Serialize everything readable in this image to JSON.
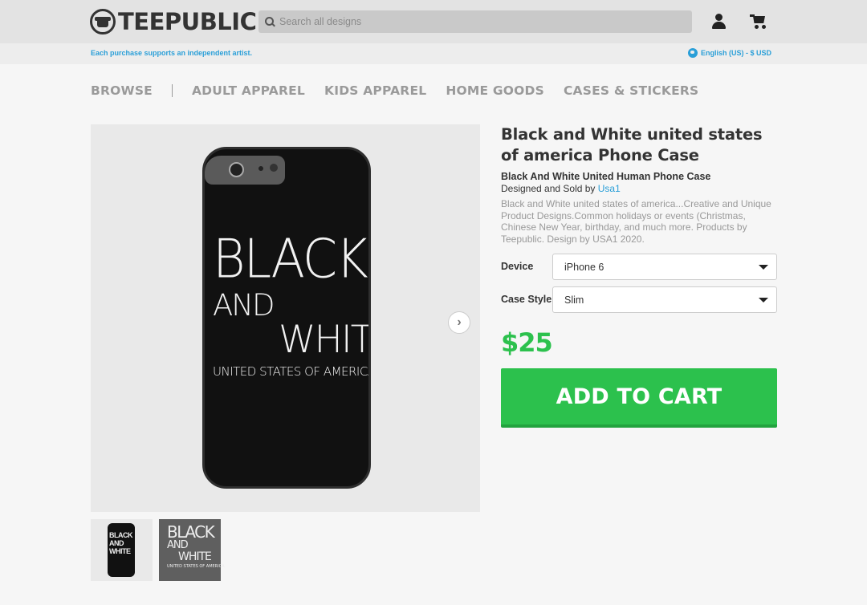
{
  "header": {
    "logo_text": "TEEPUBLIC",
    "search_placeholder": "Search all designs",
    "user_icon": "user-icon",
    "cart_icon": "cart-icon"
  },
  "subbar": {
    "tagline": "Each purchase supports an independent artist.",
    "locale": "English (US) - $ USD"
  },
  "nav": {
    "items": [
      "BROWSE",
      "ADULT APPAREL",
      "KIDS APPAREL",
      "HOME GOODS",
      "CASES & STICKERS"
    ]
  },
  "product": {
    "title": "Black and White united states of america Phone Case",
    "design_name": "Black And White United Human Phone Case",
    "byline_prefix": "Designed and Sold by",
    "artist": "Usa1",
    "description": "Black and White united states of america...Creative and Unique Product Designs.Common holidays or events (Christmas, Chinese New Year, birthday, and much more. Products by Teepublic. Design by USA1 2020.",
    "device_label": "Device",
    "device_value": "iPhone 6",
    "case_style_label": "Case Style",
    "case_style_value": "Slim",
    "price": "$25",
    "add_to_cart": "ADD TO CART"
  },
  "artwork": {
    "line1": "BLACK",
    "line2": "AND",
    "line3": "WHITE",
    "line4": "UNITED STATES OF AMERICA"
  },
  "colors": {
    "accent_green": "#2cc14d",
    "link_blue": "#2a9fd8"
  }
}
